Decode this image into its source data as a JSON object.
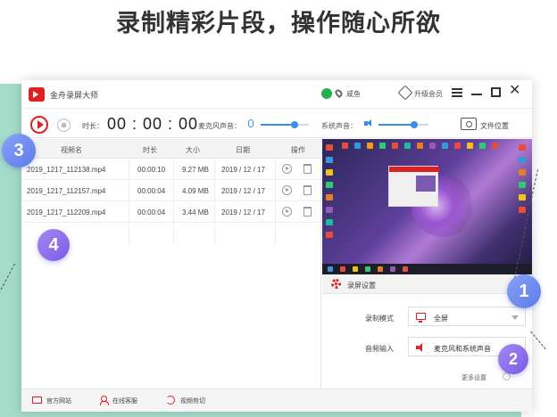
{
  "headline": "录制精彩片段，操作随心所欲",
  "titlebar": {
    "app_title": "金舟录屏大师",
    "user_name": "咸鱼",
    "vip_label": "升级会员"
  },
  "toolbar": {
    "duration_label": "时长：",
    "duration_value": "00 : 00 : 00",
    "mic_label": "麦克风声音：",
    "mic_level": 0.7,
    "sys_label": "系统声音：",
    "sys_level": 0.72,
    "folder_label": "文件位置"
  },
  "table": {
    "headers": [
      "视频名",
      "时长",
      "大小",
      "日期",
      "操作"
    ],
    "rows": [
      {
        "name": "2019_1217_112138.mp4",
        "duration": "00:00:10",
        "size": "9.27 MB",
        "date": "2019 / 12 / 17"
      },
      {
        "name": "2019_1217_112157.mp4",
        "duration": "00:00:04",
        "size": "4.09 MB",
        "date": "2019 / 12 / 17"
      },
      {
        "name": "2019_1217_112209.mp4",
        "duration": "00:00:04",
        "size": "3.44 MB",
        "date": "2019 / 12 / 17"
      }
    ]
  },
  "settings": {
    "title": "录屏设置",
    "mode_label": "录制模式",
    "mode_value": "全屏",
    "audio_label": "音频输入",
    "audio_value": "麦克风和系统声音",
    "more_label": "更多设置"
  },
  "statusbar": {
    "website": "官方网站",
    "support": "在线客服",
    "editor": "视频剪切"
  },
  "badges": [
    "1",
    "2",
    "3",
    "4"
  ],
  "colors": {
    "accent_red": "#e02020",
    "slider_blue": "#3a8ee6",
    "teal_background": "#a5dcc9"
  }
}
